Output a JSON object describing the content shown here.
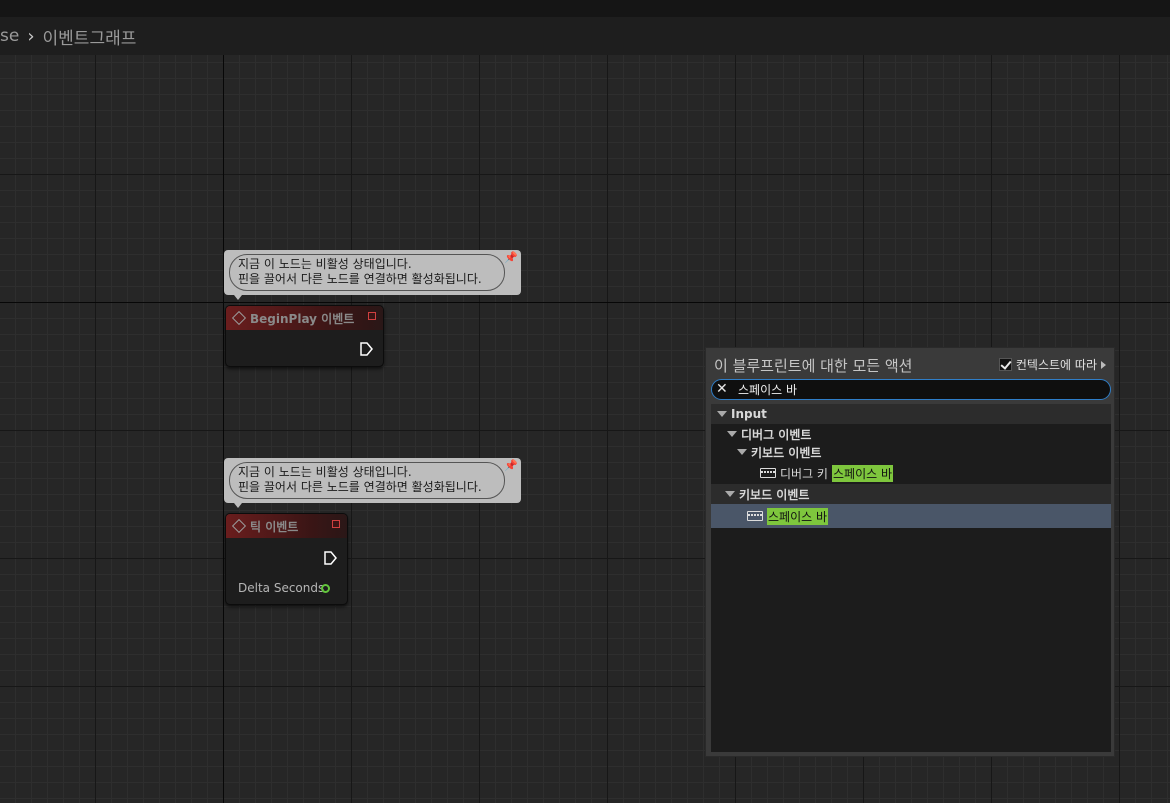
{
  "breadcrumb": {
    "prev": "se",
    "current": "이벤트그래프"
  },
  "comments": [
    {
      "line1": "지금 이 노드는 비활성 상태입니다.",
      "line2": "핀을 끌어서 다른 노드를 연결하면 활성화됩니다."
    },
    {
      "line1": "지금 이 노드는 비활성 상태입니다.",
      "line2": "핀을 끌어서 다른 노드를 연결하면 활성화됩니다."
    }
  ],
  "nodes": {
    "begin_play": {
      "title": "BeginPlay 이벤트"
    },
    "tick": {
      "title": "틱 이벤트",
      "param": "Delta Seconds"
    }
  },
  "menu": {
    "title": "이 블루프린트에 대한 모든 액션",
    "context_label": "컨텍스트에 따라",
    "context_checked": true,
    "search_value": "스페이스 바",
    "tree": {
      "category": "Input",
      "debug_events": "디버그 이벤트",
      "keyboard_events_sub": "키보드 이벤트",
      "debug_key_prefix": "디버그 키",
      "debug_key_highlight": "스페이스 바",
      "keyboard_events": "키보드 이벤트",
      "space_bar": "스페이스 바"
    }
  },
  "colors": {
    "exec_pin": "#ffffff",
    "float_pin": "#63c63c",
    "highlight": "#7ec63d",
    "search_border": "#2f7ec8",
    "selection": "#4a5668"
  }
}
